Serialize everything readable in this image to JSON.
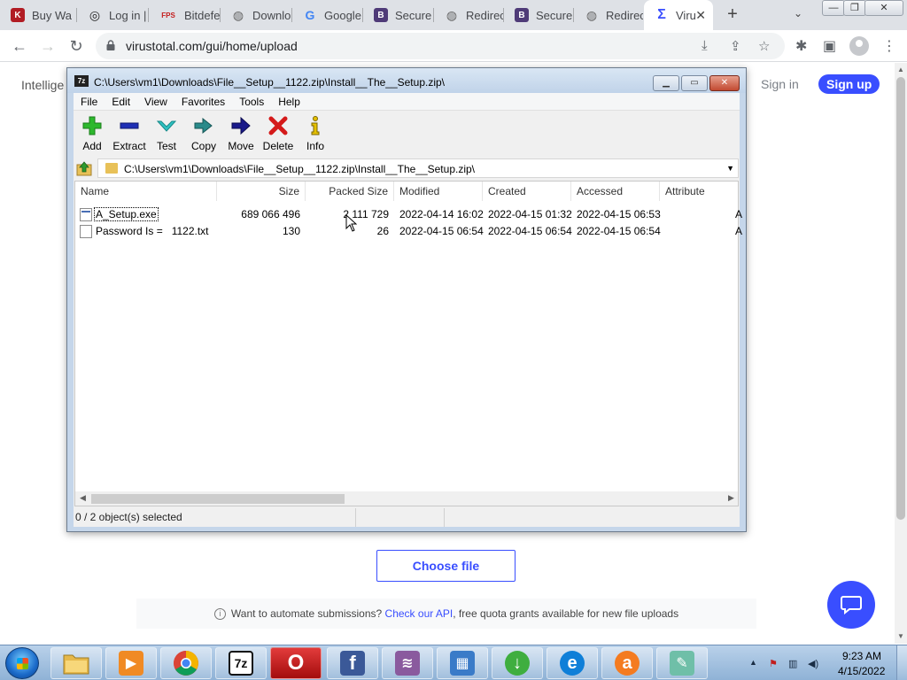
{
  "browser": {
    "tabs": [
      {
        "label": "Buy Wa",
        "icon": "km-icon",
        "glyph": "K",
        "color": "#b11c24",
        "text_color": "#fff"
      },
      {
        "label": "Log in |",
        "icon": "spiral-icon",
        "glyph": "◎",
        "color": "#ffffff",
        "text_color": "#222"
      },
      {
        "label": "Bitdefe",
        "icon": "fps-icon",
        "glyph": "FPS",
        "color": "#ffffff",
        "text_color": "#c41e1e"
      },
      {
        "label": "Downlo",
        "icon": "globe-icon",
        "glyph": "◍",
        "color": "#ffffff",
        "text_color": "#666"
      },
      {
        "label": "Google",
        "icon": "google-icon",
        "glyph": "G",
        "color": "#ffffff",
        "text_color": "#4285f4"
      },
      {
        "label": "Secure",
        "icon": "b-icon",
        "glyph": "B",
        "color": "#4f3b78",
        "text_color": "#fff"
      },
      {
        "label": "Redirec",
        "icon": "globe-icon",
        "glyph": "◍",
        "color": "#ffffff",
        "text_color": "#666"
      },
      {
        "label": "Secure",
        "icon": "b-icon",
        "glyph": "B",
        "color": "#4f3b78",
        "text_color": "#fff"
      },
      {
        "label": "Redirec",
        "icon": "globe-icon",
        "glyph": "◍",
        "color": "#ffffff",
        "text_color": "#666"
      },
      {
        "label": "Viru",
        "icon": "virustotal-icon",
        "glyph": "Σ",
        "color": "#ffffff",
        "text_color": "#394eff"
      }
    ],
    "active_tab_close": "✕",
    "new_tab": "+",
    "tab_search": "⌄",
    "window_buttons": {
      "minimize": "—",
      "maximize": "❐",
      "close": "✕"
    },
    "nav": {
      "back": "←",
      "forward": "→",
      "reload": "↻"
    },
    "url": "virustotal.com/gui/home/upload",
    "omnibox_icons": {
      "install": "⤓",
      "share": "⇪",
      "bookmark": "☆"
    },
    "toolbar_icons": {
      "extensions": "✱",
      "side_panel": "▣",
      "menu": "⋮"
    }
  },
  "page": {
    "intelligence_label": "Intellige",
    "sign_in": "Sign in",
    "sign_up": "Sign up",
    "choose_file": "Choose file",
    "api_prefix": "Want to automate submissions?",
    "api_link": "Check our API",
    "api_suffix": ", free quota grants available for new file uploads",
    "info_glyph": "i",
    "brand_color": "#394eff"
  },
  "zip": {
    "logo": "7z",
    "title": "C:\\Users\\vm1\\Downloads\\File__Setup__1122.zip\\Install__The__Setup.zip\\",
    "caption_buttons": {
      "minimize": "▁",
      "maximize": "▭",
      "close": "✕"
    },
    "menu": [
      "File",
      "Edit",
      "View",
      "Favorites",
      "Tools",
      "Help"
    ],
    "toolbar": [
      {
        "label": "Add",
        "icon": "plus-icon"
      },
      {
        "label": "Extract",
        "icon": "minus-icon"
      },
      {
        "label": "Test",
        "icon": "check-icon"
      },
      {
        "label": "Copy",
        "icon": "double-arrow-icon"
      },
      {
        "label": "Move",
        "icon": "arrow-right-icon"
      },
      {
        "label": "Delete",
        "icon": "x-icon"
      },
      {
        "label": "Info",
        "icon": "info-icon"
      }
    ],
    "address": "C:\\Users\\vm1\\Downloads\\File__Setup__1122.zip\\Install__The__Setup.zip\\",
    "columns": [
      "Name",
      "Size",
      "Packed Size",
      "Modified",
      "Created",
      "Accessed",
      "Attribute"
    ],
    "rows": [
      {
        "name": "A_Setup.exe",
        "size": "689 066 496",
        "packed": "2 111 729",
        "modified": "2022-04-14 16:02",
        "created": "2022-04-15 01:32",
        "accessed": "2022-04-15 06:53",
        "attr": "A"
      },
      {
        "name": "Password Is =   1122.txt",
        "size": "130",
        "packed": "26",
        "modified": "2022-04-15 06:54",
        "created": "2022-04-15 06:54",
        "accessed": "2022-04-15 06:54",
        "attr": "A"
      }
    ],
    "status": "0 / 2 object(s) selected"
  },
  "taskbar": {
    "apps": [
      {
        "name": "explorer",
        "icon": "folder-icon",
        "glyph": "",
        "color": "#e6b84b"
      },
      {
        "name": "media-player",
        "icon": "media-player-icon",
        "glyph": "▶",
        "color": "#f08a24"
      },
      {
        "name": "chrome",
        "icon": "chrome-icon",
        "glyph": "",
        "color": "#db4437"
      },
      {
        "name": "7zip",
        "icon": "7zip-icon",
        "glyph": "7z",
        "color": "#111111"
      },
      {
        "name": "opera",
        "icon": "opera-icon",
        "glyph": "O",
        "color": "#e0161e"
      },
      {
        "name": "facebook",
        "icon": "facebook-icon",
        "glyph": "f",
        "color": "#3b5998"
      },
      {
        "name": "winrar",
        "icon": "winrar-icon",
        "glyph": "≋",
        "color": "#8a5a9e"
      },
      {
        "name": "control-panel",
        "icon": "control-panel-icon",
        "glyph": "▦",
        "color": "#3a7bc8"
      },
      {
        "name": "download-manager",
        "icon": "download-icon",
        "glyph": "↓",
        "color": "#3fae3f"
      },
      {
        "name": "edge",
        "icon": "edge-icon",
        "glyph": "e",
        "color": "#0f7fd8"
      },
      {
        "name": "avast",
        "icon": "avast-icon",
        "glyph": "a",
        "color": "#f47b20"
      },
      {
        "name": "notepad",
        "icon": "notepad-icon",
        "glyph": "✎",
        "color": "#6fbfa8"
      }
    ],
    "time": "9:23 AM",
    "date": "4/15/2022",
    "tray_icons": {
      "expand": "▲",
      "flag": "⚑",
      "network": "▥",
      "volume": "◀)"
    }
  }
}
